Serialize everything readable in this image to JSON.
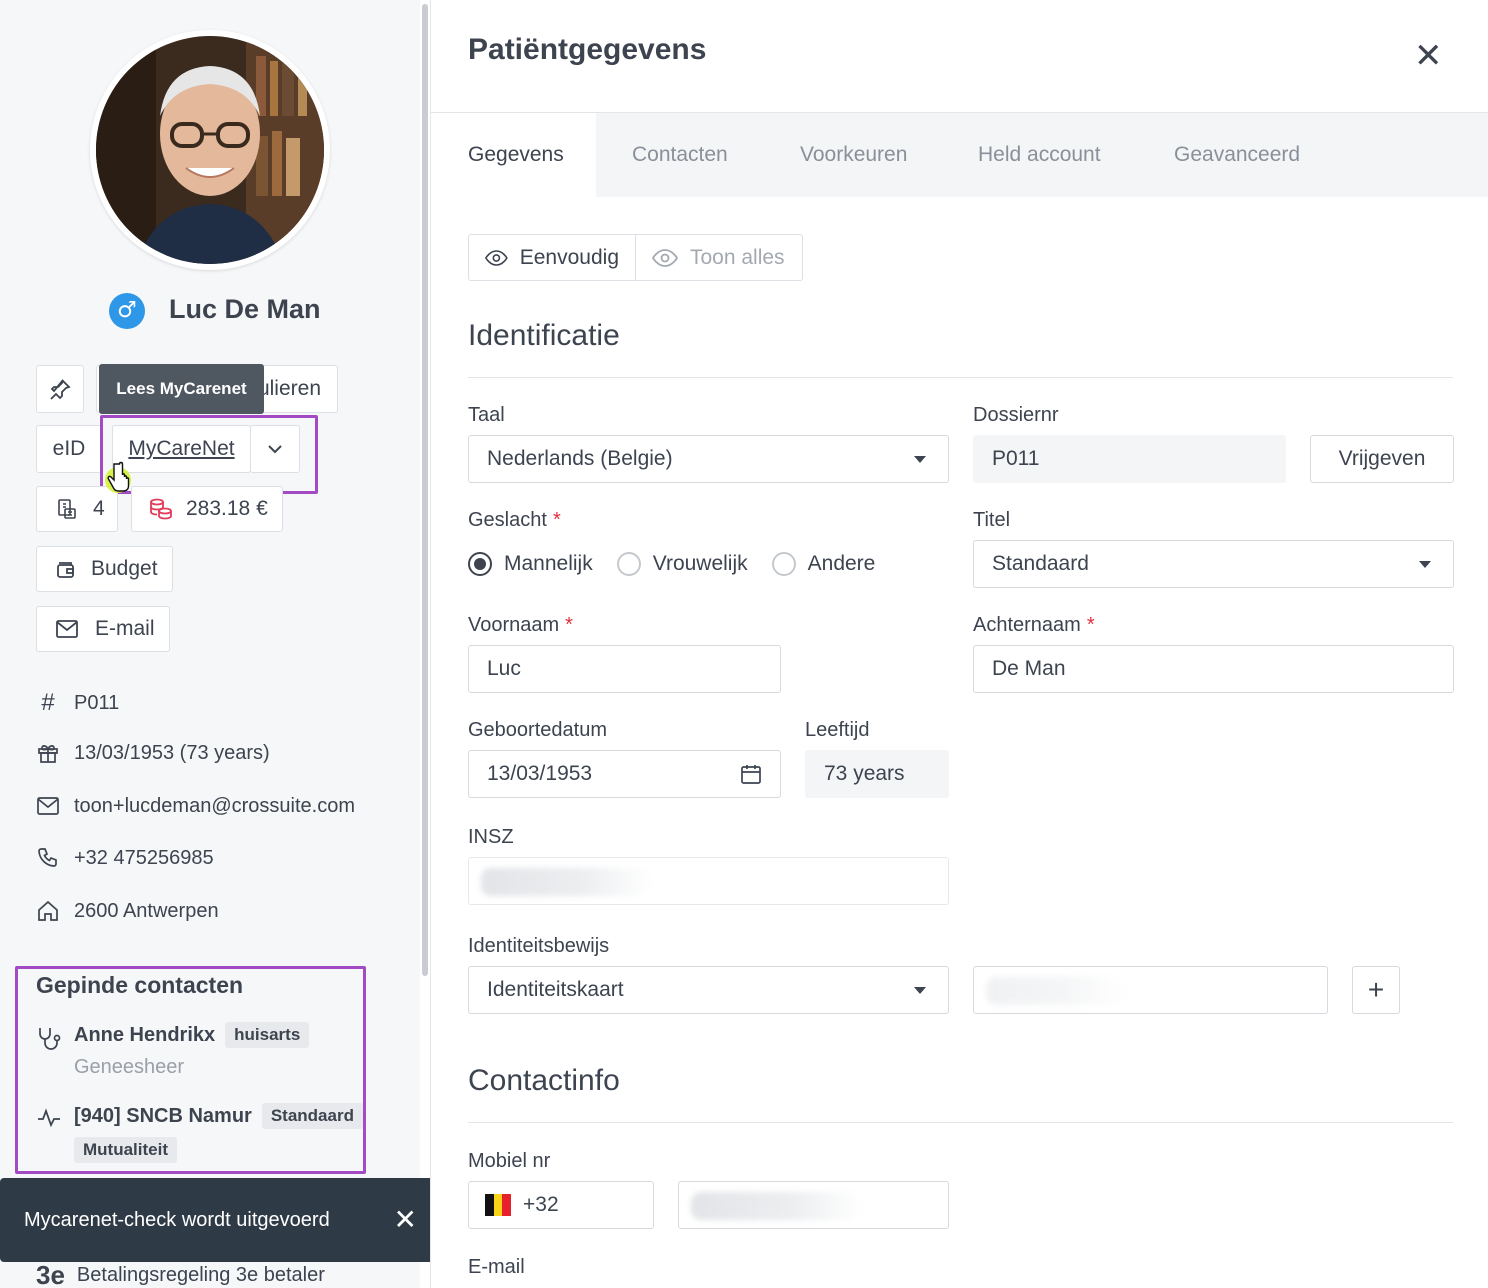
{
  "sidebar": {
    "patient_name": "Luc De Man",
    "gender_symbol": "♂",
    "tooltip": "Lees MyCarenet",
    "buttons": {
      "formulieren_partial": "ulieren",
      "eid": "eID",
      "mycarenet": "MyCareNet",
      "docs_count": "4",
      "balance": "283.18 €",
      "budget": "Budget",
      "email": "E-mail"
    },
    "info": {
      "id": "P011",
      "birth": "13/03/1953 (73 years)",
      "email": "toon+lucdeman@crossuite.com",
      "phone": "+32 475256985",
      "address": "2600 Antwerpen"
    },
    "pinned": {
      "title": "Gepinde contacten",
      "contacts": [
        {
          "name": "Anne Hendrikx",
          "tag": "huisarts",
          "sub": "Geneesheer"
        },
        {
          "name": "[940] SNCB Namur",
          "tag": "Standaard",
          "tag2": "Mutualiteit"
        }
      ]
    },
    "toast": "Mycarenet-check wordt uitgevoerd",
    "toast_close": "✕",
    "bottom_item": "Betalingsregeling 3e betaler",
    "bottom_icon_text": "3e"
  },
  "main": {
    "title": "Patiëntgegevens",
    "close": "✕",
    "tabs": [
      "Gegevens",
      "Contacten",
      "Voorkeuren",
      "Held account",
      "Geavanceerd"
    ],
    "view_modes": [
      "Eenvoudig",
      "Toon alles"
    ],
    "sections": {
      "identificatie": "Identificatie",
      "contactinfo": "Contactinfo"
    },
    "fields": {
      "taal_label": "Taal",
      "taal_value": "Nederlands (Belgie)",
      "dossier_label": "Dossiernr",
      "dossier_value": "P011",
      "vrijgeven": "Vrijgeven",
      "geslacht_label": "Geslacht",
      "geslacht_options": [
        "Mannelijk",
        "Vrouwelijk",
        "Andere"
      ],
      "titel_label": "Titel",
      "titel_value": "Standaard",
      "voornaam_label": "Voornaam",
      "voornaam_value": "Luc",
      "achternaam_label": "Achternaam",
      "achternaam_value": "De Man",
      "geboortedatum_label": "Geboortedatum",
      "geboortedatum_value": "13/03/1953",
      "leeftijd_label": "Leeftijd",
      "leeftijd_value": "73 years",
      "insz_label": "INSZ",
      "id_label": "Identiteitsbewijs",
      "id_value": "Identiteitskaart",
      "add": "+",
      "mobiel_label": "Mobiel nr",
      "mobiel_prefix": "+32",
      "email_label": "E-mail",
      "required_mark": "*"
    }
  },
  "colors": {
    "accent_highlight": "#a24bc4",
    "gender_badge": "#2f97e8",
    "required": "#e0303e",
    "toast_bg": "#2f3a47"
  }
}
